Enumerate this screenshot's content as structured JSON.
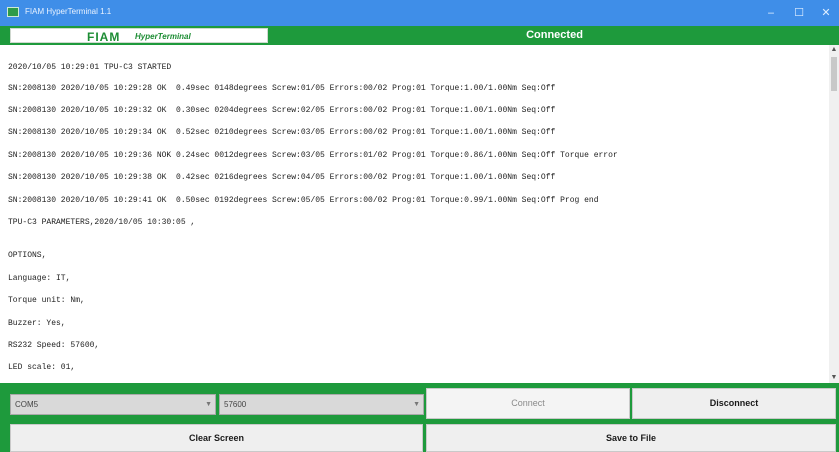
{
  "window": {
    "title": "FIAM HyperTerminal 1.1",
    "controls": {
      "minimize": "‒",
      "maximize": "☐",
      "close": "✕"
    }
  },
  "header": {
    "brand": "FIAM",
    "brand_sub": "HyperTerminal",
    "status": "Connected"
  },
  "terminal": {
    "lines": [
      "2020/10/05 10:29:01 TPU-C3 STARTED",
      "SN:2008130 2020/10/05 10:29:28 OK  0.49sec 0148degrees Screw:01/05 Errors:00/02 Prog:01 Torque:1.00/1.00Nm Seq:Off",
      "SN:2008130 2020/10/05 10:29:32 OK  0.30sec 0204degrees Screw:02/05 Errors:00/02 Prog:01 Torque:1.00/1.00Nm Seq:Off",
      "SN:2008130 2020/10/05 10:29:34 OK  0.52sec 0210degrees Screw:03/05 Errors:00/02 Prog:01 Torque:1.00/1.00Nm Seq:Off",
      "SN:2008130 2020/10/05 10:29:36 NOK 0.24sec 0012degrees Screw:03/05 Errors:01/02 Prog:01 Torque:0.86/1.00Nm Seq:Off Torque error",
      "SN:2008130 2020/10/05 10:29:38 OK  0.42sec 0216degrees Screw:04/05 Errors:00/02 Prog:01 Torque:1.00/1.00Nm Seq:Off",
      "SN:2008130 2020/10/05 10:29:41 OK  0.50sec 0192degrees Screw:05/05 Errors:00/02 Prog:01 Torque:0.99/1.00Nm Seq:Off Prog end",
      "TPU-C3 PARAMETERS,2020/10/05 10:30:05 ,",
      "OPTIONS,",
      "Language: IT,",
      "Torque unit: Nm,",
      "Buzzer: Yes,",
      "RS232 Speed: 57600,",
      "LED scale: 01,"
    ]
  },
  "controls": {
    "port": "COM5",
    "baud": "57600",
    "connect_label": "Connect",
    "disconnect_label": "Disconnect",
    "clear_label": "Clear Screen",
    "save_label": "Save to File"
  }
}
